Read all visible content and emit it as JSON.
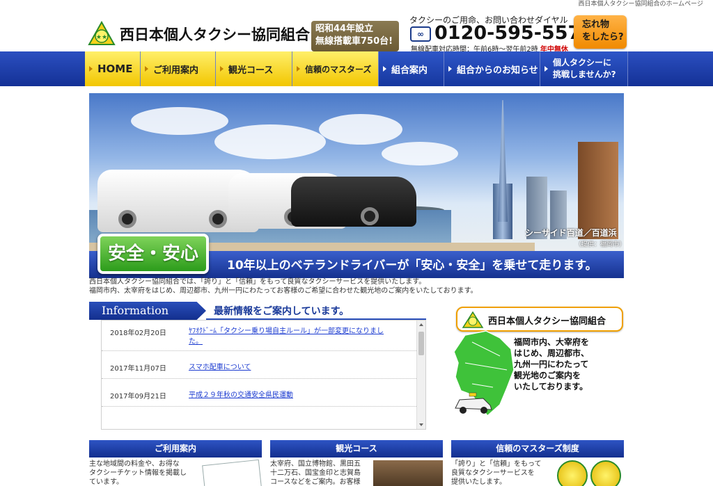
{
  "tagline": "西日本個人タクシー協同組合のホームページ",
  "header": {
    "title": "西日本個人タクシー協同組合",
    "est_line1": "昭和44年設立",
    "est_line2": "無線搭載車750台!",
    "phone_label": "タクシーのご用命、お問い合わせダイヤル",
    "phone_icon_text": "∞",
    "phone_number": "0120-595-557",
    "hours": "無線配車対応時間：午前6時～翌午前2時",
    "hours_note": "年中無休",
    "lost_line1": "忘れ物",
    "lost_line2": "をしたら?"
  },
  "nav": {
    "items": [
      {
        "label": "HOME"
      },
      {
        "label": "ご利用案内"
      },
      {
        "label": "観光コース"
      },
      {
        "label": "信頼のマスターズ"
      },
      {
        "label": "組合案内"
      },
      {
        "label": "組合からのお知らせ"
      },
      {
        "label_line1": "個人タクシーに",
        "label_line2": "挑戦しませんか?"
      }
    ]
  },
  "hero": {
    "caption": "シーサイド百道／百道浜",
    "credit": "（提供：福岡市）",
    "badge": "安全・安心",
    "slogan": "10年以上のベテランドライバーが「安心・安全」を乗せて走ります。"
  },
  "intro": {
    "line1": "西日本個人タクシー協同組合では、「誇り」と「信頼」をもって良質なタクシーサービスを提供いたします。",
    "line2": "福岡市内、太宰府をはじめ、周辺都市、九州一円にわたってお客様のご希望に合わせた観光地のご案内をいたしております。"
  },
  "info": {
    "tab": "Information",
    "heading": "最新情報をご案内しています。",
    "items": [
      {
        "date": "2018年02月20日",
        "title": "ﾔﾌｵｸﾄﾞｰﾑ「タクシー乗り場自主ルール」が一部変更になりました。"
      },
      {
        "date": "2017年11月07日",
        "title": "スマホ配車について"
      },
      {
        "date": "2017年09月21日",
        "title": "平成２９年秋の交通安全県民運動"
      }
    ]
  },
  "side": {
    "title": "西日本個人タクシー協同組合",
    "line1": "福岡市内、大宰府を",
    "line2": "はじめ、周辺都市、",
    "line3": "九州一円にわたって",
    "line4": "観光地のご案内を",
    "line5": "いたしております。"
  },
  "columns": [
    {
      "title": "ご利用案内",
      "line1": "主な地域間の料金や、お得な",
      "line2": "タクシーチケット情報を掲載し",
      "line3": "ています。"
    },
    {
      "title": "観光コース",
      "line1": "太宰府、国立博物館、黒田五",
      "line2": "十二万石、国宝金印と志賀島",
      "line3": "コースなどをご案内。お客様"
    },
    {
      "title": "信頼のマスターズ制度",
      "line1": "「誇り」と「信頼」をもって",
      "line2": "良質なタクシーサービスを",
      "line3": "提供いたします。"
    }
  ],
  "colors": {
    "nav_blue": "#1a3aa8",
    "nav_yellow": "#f7d21a",
    "accent_orange": "#f08a00",
    "badge_green": "#3aae24"
  }
}
